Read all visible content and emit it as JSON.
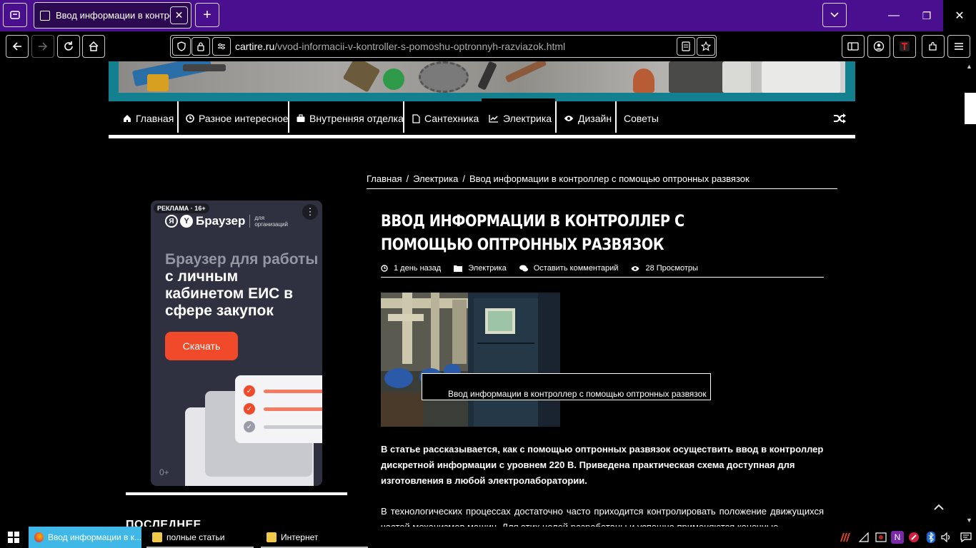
{
  "browser": {
    "tab_title": "Ввод информации в контрол",
    "tab_close": "✕",
    "new_tab": "+",
    "url_host": "cartire.ru",
    "url_path": "/vvod-informacii-v-kontroller-s-pomoshu-optronnyh-razviazok.html",
    "window_controls": {
      "minimize": "—",
      "restore": "❐",
      "close": "✕"
    }
  },
  "site": {
    "menu": [
      {
        "label": "Главная",
        "icon": "home-icon"
      },
      {
        "label": "Разное интересное",
        "icon": "clock-icon"
      },
      {
        "label": "Внутренняя отделка",
        "icon": "briefcase-icon"
      },
      {
        "label": "Сантехника",
        "icon": "file-icon"
      },
      {
        "label": "Электрика",
        "icon": "chart-icon"
      },
      {
        "label": "Дизайн",
        "icon": "eye-icon"
      },
      {
        "label": "Советы",
        "icon": ""
      }
    ],
    "random_icon": "shuffle-icon"
  },
  "ad": {
    "badge": "РЕКЛАМА · 16+",
    "menu_glyph": "⋮",
    "brand": "Браузер",
    "brand_sub": "для организаций",
    "headline_grey": "Браузер для работы",
    "headline_white": " с личным кабинетом ЕИС в сфере закупок",
    "cta": "Скачать",
    "age": "0+"
  },
  "sidebar": {
    "section_title": "ПОСЛЕДНЕЕ"
  },
  "article": {
    "breadcrumbs": [
      "Главная",
      "Электрика",
      "Ввод информации в контроллер с помощью оптронных развязок"
    ],
    "breadcrumb_sep": "/",
    "title": "Ввод информации в контроллер с помощью оптронных развязок",
    "meta": {
      "date": "1 день назад",
      "category": "Электрика",
      "comments": "Оставить комментарий",
      "views": "28 Просмотры"
    },
    "image_caption": "Ввод информации в контроллер с помощью оптронных развязок",
    "lead": "В статье рассказывается, как с помощью оптронных развязок осуществить ввод в контроллер дискретной информации с уровнем 220 В. Приведена практическая схема доступная для изготовления в любой электролаборатории.",
    "body": "В технологических процессах достаточно часто приходится контролировать положение движущихся частей механизмов машин. Для этих целей разработаны и успешно применяются конечные"
  },
  "taskbar": {
    "items": [
      {
        "label": "Ввод информации в к...",
        "icon": "firefox-icon"
      },
      {
        "label": "полные статьи",
        "icon": "folder-icon"
      },
      {
        "label": "Интернет",
        "icon": "folder-icon"
      }
    ]
  },
  "colors": {
    "tabbar": "#4a0f8e",
    "banner_frame": "#12808f",
    "ad_bg": "#2f3140",
    "ad_cta": "#f04a2a"
  }
}
